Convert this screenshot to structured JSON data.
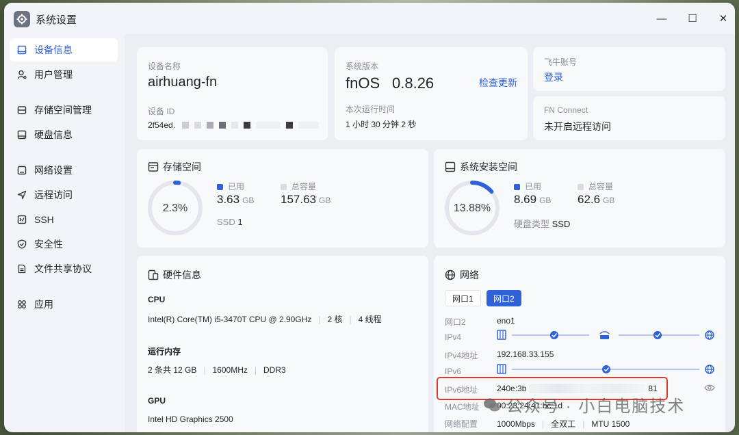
{
  "window": {
    "title": "系统设置",
    "minimize": "—",
    "maximize": "☐",
    "close": "✕"
  },
  "sidebar": {
    "items": [
      {
        "label": "设备信息",
        "icon": "device-icon",
        "active": true
      },
      {
        "label": "用户管理",
        "icon": "user-icon"
      },
      {
        "label": "存储空间管理",
        "icon": "storage-icon"
      },
      {
        "label": "硬盘信息",
        "icon": "disk-icon"
      },
      {
        "label": "网络设置",
        "icon": "network-icon"
      },
      {
        "label": "远程访问",
        "icon": "remote-icon"
      },
      {
        "label": "SSH",
        "icon": "ssh-icon"
      },
      {
        "label": "安全性",
        "icon": "shield-icon"
      },
      {
        "label": "文件共享协议",
        "icon": "file-icon"
      },
      {
        "label": "应用",
        "icon": "apps-icon"
      }
    ]
  },
  "device": {
    "name_label": "设备名称",
    "name": "airhuang-fn",
    "id_label": "设备 ID",
    "id_value": "2f54ed."
  },
  "version": {
    "label": "系统版本",
    "os": "fnOS",
    "number": "0.8.26",
    "check_update": "检查更新",
    "uptime_label": "本次运行时间",
    "uptime": "1 小时 30 分钟 2 秒"
  },
  "account": {
    "label": "飞牛账号",
    "login": "登录"
  },
  "fnconnect": {
    "label": "FN Connect",
    "status": "未开启远程访问"
  },
  "storage": {
    "title": "存储空间",
    "percent_text": "2.3%",
    "percent": 0.023,
    "used_label": "已用",
    "used": "3.63",
    "used_unit": "GB",
    "total_label": "总容量",
    "total": "157.63",
    "total_unit": "GB",
    "disk_type": "SSD",
    "disk_count": "1"
  },
  "system_space": {
    "title": "系统安装空间",
    "percent_text": "13.88%",
    "percent": 0.1388,
    "used_label": "已用",
    "used": "8.69",
    "used_unit": "GB",
    "total_label": "总容量",
    "total": "62.6",
    "total_unit": "GB",
    "disk_type_label": "硬盘类型",
    "disk_type": "SSD"
  },
  "hardware": {
    "title": "硬件信息",
    "cpu_label": "CPU",
    "cpu_model": "Intel(R) Core(TM) i5-3470T CPU @ 2.90GHz",
    "cpu_cores": "2 核",
    "cpu_threads": "4 线程",
    "mem_label": "运行内存",
    "mem_count": "2 条共 12 GB",
    "mem_freq": "1600MHz",
    "mem_type": "DDR3",
    "gpu_label": "GPU",
    "gpu_model": "Intel HD Graphics 2500"
  },
  "network": {
    "title": "网络",
    "tabs": [
      {
        "label": "网口1",
        "active": false
      },
      {
        "label": "网口2",
        "active": true
      }
    ],
    "port_label": "网口2",
    "port_value": "eno1",
    "ipv4_label": "IPv4",
    "ipv4_addr_label": "IPv4地址",
    "ipv4_addr": "192.168.33.155",
    "ipv6_label": "IPv6",
    "ipv6_addr_label": "IPv6地址",
    "ipv6_prefix": "240e:3b",
    "ipv6_suffix": "81",
    "mac_label": "MAC地址",
    "mac": "00:23:24:41:bc:1d",
    "config_label": "网络配置",
    "speed": "1000Mbps",
    "duplex": "全双工",
    "mtu": "MTU 1500",
    "highlight_color": "#e0392b"
  },
  "watermark": "公众号 · 小白电脑技术",
  "colors": {
    "accent": "#2f62d6",
    "ring_track": "#e3e6ec"
  }
}
